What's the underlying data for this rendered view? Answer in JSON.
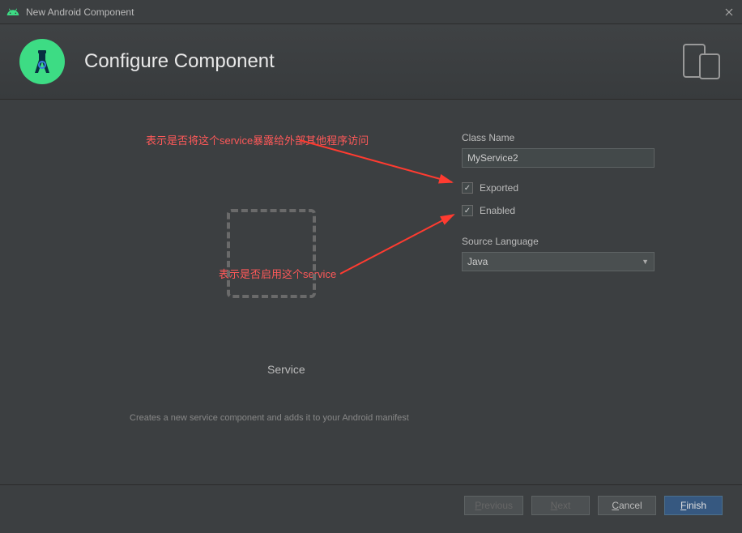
{
  "window": {
    "title": "New Android Component",
    "heading": "Configure Component"
  },
  "annotations": {
    "exported_hint": "表示是否将这个service暴露给外部其他程序访问",
    "enabled_hint": "表示是否启用这个service"
  },
  "preview": {
    "label": "Service",
    "description": "Creates a new service component and adds it to your Android manifest"
  },
  "form": {
    "class_name_label": "Class Name",
    "class_name_value": "MyService2",
    "exported_label": "Exported",
    "exported_checked": true,
    "enabled_label": "Enabled",
    "enabled_checked": true,
    "source_language_label": "Source Language",
    "source_language_value": "Java"
  },
  "buttons": {
    "previous": "Previous",
    "next": "Next",
    "cancel": "Cancel",
    "finish": "Finish"
  }
}
